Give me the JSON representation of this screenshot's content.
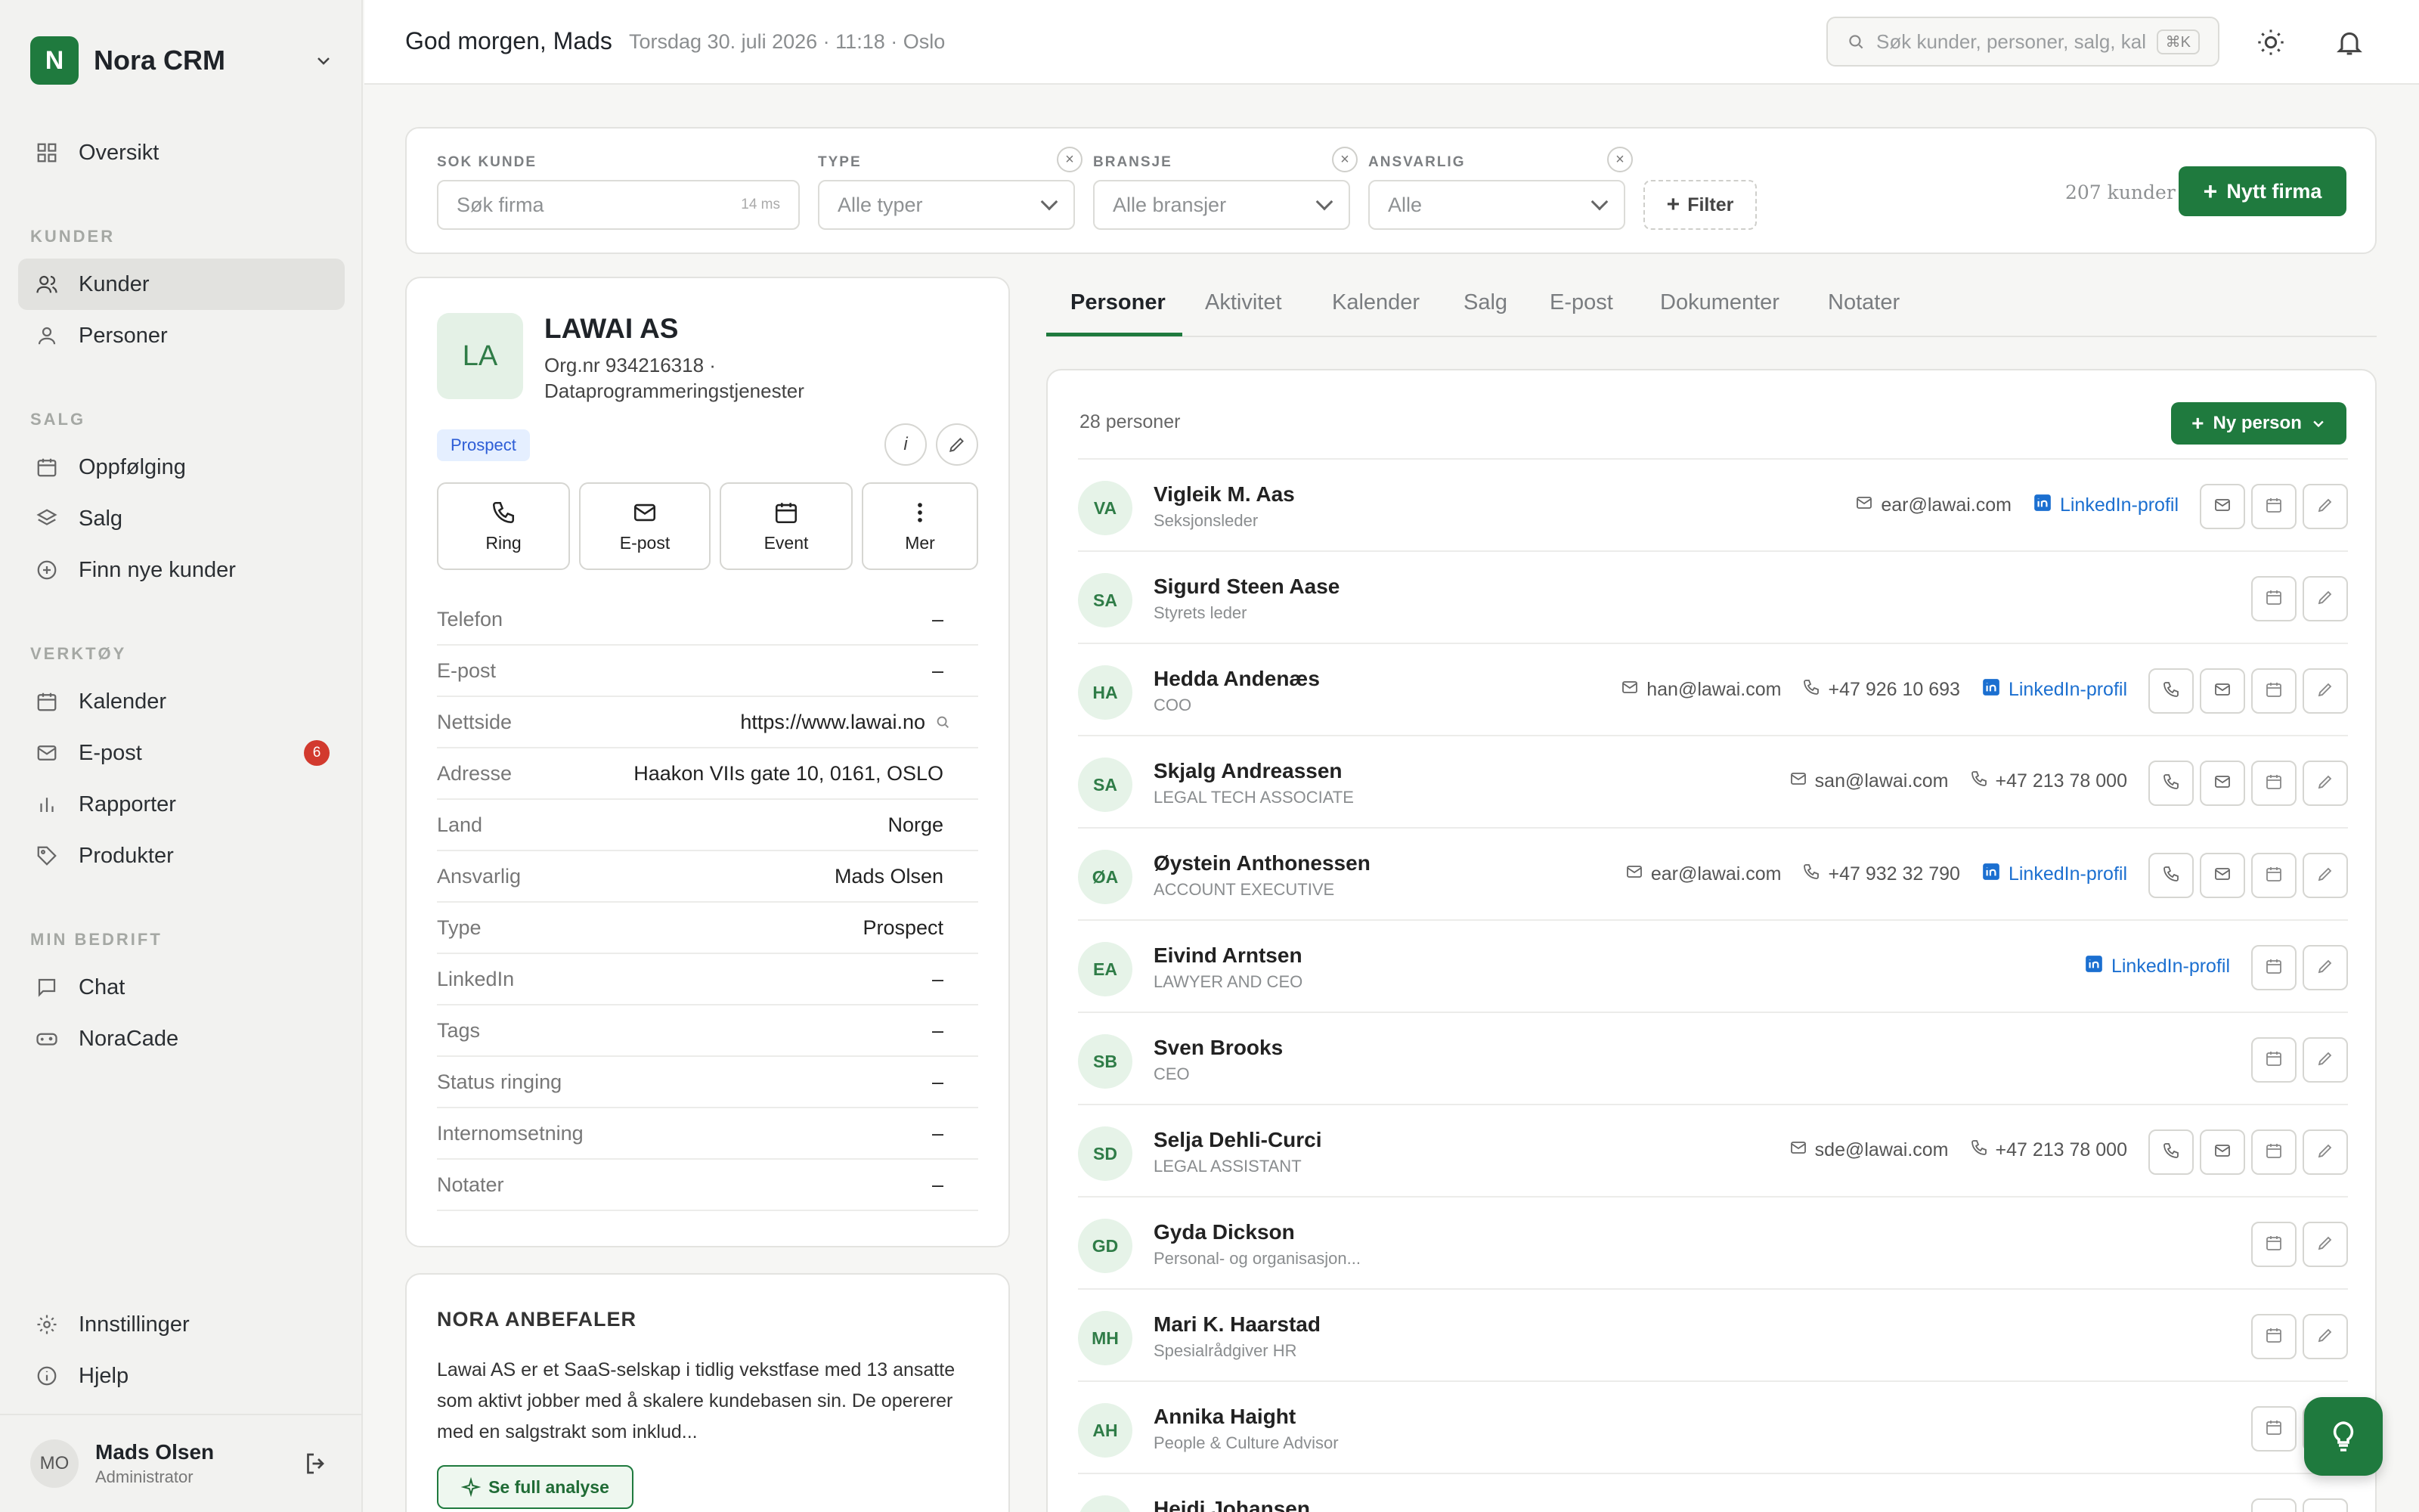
{
  "brand": {
    "logo_letter": "N",
    "name": "Nora CRM"
  },
  "nav": {
    "overview": "Oversikt",
    "sec_customers": "KUNDER",
    "customers": "Kunder",
    "persons": "Personer",
    "sec_sales": "SALG",
    "followup": "Oppfølging",
    "sales": "Salg",
    "find_new": "Finn nye kunder",
    "sec_tools": "VERKTØY",
    "calendar": "Kalender",
    "email": "E-post",
    "email_badge": "6",
    "reports": "Rapporter",
    "products": "Produkter",
    "sec_company": "MIN BEDRIFT",
    "chat": "Chat",
    "noracade": "NoraCade",
    "settings": "Innstillinger",
    "help": "Hjelp"
  },
  "user": {
    "initials": "MO",
    "name": "Mads Olsen",
    "role": "Administrator"
  },
  "topbar": {
    "greeting": "God morgen, Mads",
    "date": "Torsdag 30. juli 2026 · 11:18 · Oslo",
    "search_placeholder": "Søk kunder, personer, salg, kal",
    "search_kbd": "⌘K"
  },
  "filters": {
    "search_label": "SOK KUNDE",
    "search_placeholder": "Søk firma",
    "search_timing": "14 ms",
    "type_label": "TYPE",
    "type_value": "Alle typer",
    "industry_label": "BRANSJE",
    "industry_value": "Alle bransjer",
    "owner_label": "ANSVARLIG",
    "owner_value": "Alle",
    "filter_button": "Filter",
    "count": "207 kunder",
    "new_company": "Nytt firma"
  },
  "company": {
    "initials": "LA",
    "name": "LAWAI AS",
    "org": "Org.nr 934216318 ·",
    "industry": "Dataprogrammeringstjenester",
    "badge": "Prospect",
    "actions": {
      "call": "Ring",
      "email": "E-post",
      "event": "Event",
      "more": "Mer"
    },
    "fields": [
      {
        "k": "Telefon",
        "v": "–"
      },
      {
        "k": "E-post",
        "v": "–"
      },
      {
        "k": "Nettside",
        "v": "https://www.lawai.no"
      },
      {
        "k": "Adresse",
        "v": "Haakon VIIs gate 10, 0161, OSLO"
      },
      {
        "k": "Land",
        "v": "Norge"
      },
      {
        "k": "Ansvarlig",
        "v": "Mads Olsen"
      },
      {
        "k": "Type",
        "v": "Prospect"
      },
      {
        "k": "LinkedIn",
        "v": "–"
      },
      {
        "k": "Tags",
        "v": "–"
      },
      {
        "k": "Status ringing",
        "v": "–"
      },
      {
        "k": "Internomsetning",
        "v": "–"
      },
      {
        "k": "Notater",
        "v": "–"
      }
    ]
  },
  "recommend": {
    "title": "NORA ANBEFALER",
    "text": "Lawai AS er et SaaS-selskap i tidlig vekstfase med 13 ansatte som aktivt jobber med å skalere kundebasen sin. De opererer med en salgstrakt som inklud...",
    "button": "Se full analyse"
  },
  "tabs": [
    "Personer",
    "Aktivitet",
    "Kalender",
    "Salg",
    "E-post",
    "Dokumenter",
    "Notater"
  ],
  "people": {
    "count": "28 personer",
    "new_button": "Ny person",
    "linkedin_label": "LinkedIn-profil",
    "rows": [
      {
        "initials": "VA",
        "name": "Vigleik M. Aas",
        "title": "Seksjonsleder",
        "email": "ear@lawai.com",
        "phone": "",
        "linkedin": true
      },
      {
        "initials": "SA",
        "name": "Sigurd Steen Aase",
        "title": "Styrets leder",
        "email": "",
        "phone": "",
        "linkedin": false
      },
      {
        "initials": "HA",
        "name": "Hedda Andenæs",
        "title": "COO",
        "email": "han@lawai.com",
        "phone": "+47 926 10 693",
        "linkedin": true
      },
      {
        "initials": "SA",
        "name": "Skjalg Andreassen",
        "title": "LEGAL TECH ASSOCIATE",
        "email": "san@lawai.com",
        "phone": "+47 213 78 000",
        "linkedin": false
      },
      {
        "initials": "ØA",
        "name": "Øystein Anthonessen",
        "title": "ACCOUNT EXECUTIVE",
        "email": "ear@lawai.com",
        "phone": "+47 932 32 790",
        "linkedin": true
      },
      {
        "initials": "EA",
        "name": "Eivind Arntsen",
        "title": "LAWYER AND CEO",
        "email": "",
        "phone": "",
        "linkedin": true
      },
      {
        "initials": "SB",
        "name": "Sven Brooks",
        "title": "CEO",
        "email": "",
        "phone": "",
        "linkedin": false
      },
      {
        "initials": "SD",
        "name": "Selja Dehli-Curci",
        "title": "LEGAL ASSISTANT",
        "email": "sde@lawai.com",
        "phone": "+47 213 78 000",
        "linkedin": false
      },
      {
        "initials": "GD",
        "name": "Gyda Dickson",
        "title": "Personal- og organisasjon...",
        "email": "",
        "phone": "",
        "linkedin": false
      },
      {
        "initials": "MH",
        "name": "Mari K. Haarstad",
        "title": "Spesialrådgiver HR",
        "email": "",
        "phone": "",
        "linkedin": false
      },
      {
        "initials": "AH",
        "name": "Annika Haight",
        "title": "People & Culture Advisor",
        "email": "",
        "phone": "",
        "linkedin": false
      },
      {
        "initials": "HJ",
        "name": "Heidi Johansen",
        "title": "",
        "email": "",
        "phone": "",
        "linkedin": false
      }
    ]
  },
  "colors": {
    "accent": "#1f7a3e",
    "badge_red": "#d23a2e",
    "link_blue": "#1b6fd0"
  }
}
